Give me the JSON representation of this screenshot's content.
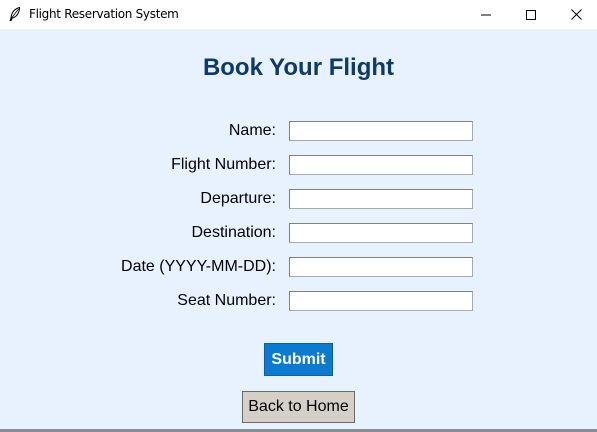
{
  "window": {
    "title": "Flight Reservation System",
    "icon": "feather-icon",
    "controls": [
      "minimize-icon",
      "maximize-icon",
      "close-icon"
    ]
  },
  "form": {
    "heading": "Book Your Flight",
    "fields": [
      {
        "label": "Name:",
        "value": ""
      },
      {
        "label": "Flight Number:",
        "value": ""
      },
      {
        "label": "Departure:",
        "value": ""
      },
      {
        "label": "Destination:",
        "value": ""
      },
      {
        "label": "Date (YYYY-MM-DD):",
        "value": ""
      },
      {
        "label": "Seat Number:",
        "value": ""
      }
    ],
    "submit_label": "Submit",
    "back_label": "Back to Home"
  },
  "colors": {
    "background": "#e8f2ff",
    "heading": "#0e3a6a",
    "submit_bg": "#0b7ad1",
    "back_bg": "#d4d0c8"
  }
}
